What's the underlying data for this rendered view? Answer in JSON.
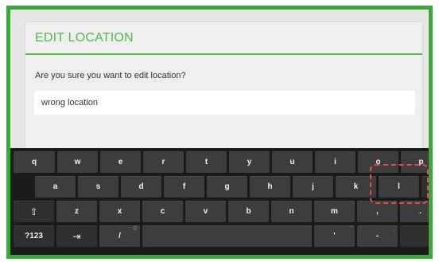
{
  "dialog": {
    "title": "EDIT LOCATION",
    "message": "Are you sure you want to edit location?",
    "input_value": "wrong location"
  },
  "colors": {
    "accent": "#55b84f",
    "frame_border": "#3aa83a",
    "highlight": "#e24b4b",
    "key_bg": "#3d3d3d",
    "keyboard_bg": "#1b1b1b"
  },
  "keyboard": {
    "row1": [
      "q",
      "w",
      "e",
      "r",
      "t",
      "y",
      "u",
      "i",
      "o",
      "p"
    ],
    "row2": [
      "a",
      "s",
      "d",
      "f",
      "g",
      "h",
      "j",
      "k",
      "l"
    ],
    "row3": [
      "z",
      "x",
      "c",
      "v",
      "b",
      "n",
      "m",
      ",",
      "."
    ],
    "hints": {
      "comma": "!",
      "period": "?",
      "slash": "@",
      "quote": "\"",
      "dash": "_"
    },
    "labels": {
      "backspace": "⌫",
      "enter": "↵",
      "shift": "⇧",
      "smiley": ":-)",
      "symbols": "?123",
      "tab": "⇥",
      "slash": "/",
      "quote": "'",
      "dash": "-",
      "settings": "⚙"
    },
    "icons": {
      "backspace": "backspace-icon",
      "enter": "enter-icon",
      "shift": "shift-icon",
      "tab": "tab-icon",
      "settings": "keyboard-settings-icon"
    }
  }
}
